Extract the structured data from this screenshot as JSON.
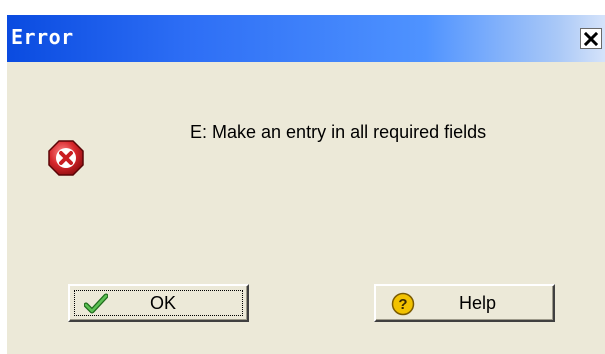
{
  "window": {
    "title": "Error",
    "close_icon": "close-icon"
  },
  "message": {
    "icon": "error-icon",
    "text": "E: Make an entry in all required fields"
  },
  "buttons": {
    "ok": {
      "label": "OK",
      "icon": "checkmark-icon"
    },
    "help": {
      "label": "Help",
      "icon": "help-icon"
    }
  },
  "colors": {
    "title_start": "#0a4be0",
    "title_end": "#d5e3fa",
    "dialog_bg": "#ece9d8",
    "error_red": "#d6262b",
    "check_green": "#3f9a3a",
    "help_yellow": "#f2c200"
  }
}
